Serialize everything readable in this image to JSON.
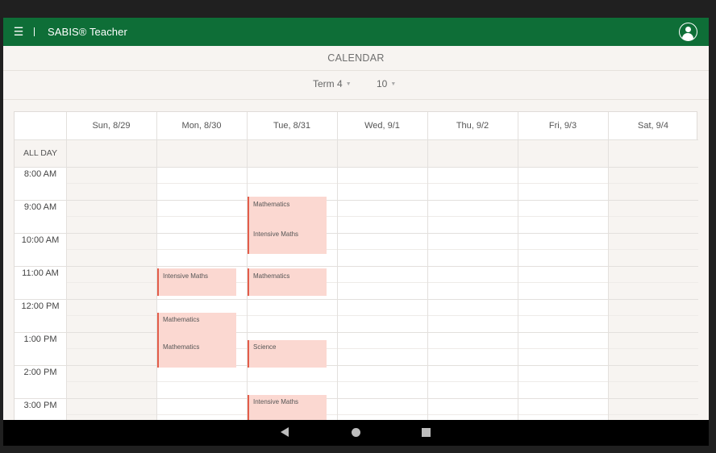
{
  "appbar": {
    "title": "SABIS® Teacher",
    "menu_icon": "hamburger-menu-icon",
    "separator": "|",
    "account_icon": "account-circle-icon",
    "color": "#0e6e37"
  },
  "calendar": {
    "title": "CALENDAR",
    "term_select": {
      "value": "Term 4"
    },
    "week_select": {
      "value": "10"
    },
    "all_day_label": "ALL DAY",
    "days": [
      "Sun, 8/29",
      "Mon, 8/30",
      "Tue, 8/31",
      "Wed, 9/1",
      "Thu, 9/2",
      "Fri, 9/3",
      "Sat, 9/4"
    ],
    "times": [
      "8:00 AM",
      "9:00 AM",
      "10:00 AM",
      "11:00 AM",
      "12:00 PM",
      "1:00 PM",
      "2:00 PM",
      "3:00 PM"
    ],
    "events": [
      {
        "day": "Tue, 8/31",
        "start": "9:00 AM",
        "end": "10:40 AM",
        "title": "Mathematics",
        "subtitle": "Intensive Maths"
      },
      {
        "day": "Mon, 8/30",
        "start": "11:00 AM",
        "end": "11:50 AM",
        "title": "Intensive Maths",
        "subtitle": ""
      },
      {
        "day": "Tue, 8/31",
        "start": "11:00 AM",
        "end": "11:50 AM",
        "title": "Mathematics",
        "subtitle": ""
      },
      {
        "day": "Mon, 8/30",
        "start": "12:20 PM",
        "end": "2:00 PM",
        "title": "Mathematics",
        "subtitle": "Mathematics"
      },
      {
        "day": "Tue, 8/31",
        "start": "1:15 PM",
        "end": "2:05 PM",
        "title": "Science",
        "subtitle": ""
      },
      {
        "day": "Tue, 8/31",
        "start": "2:55 PM",
        "end": "",
        "title": "Intensive Maths",
        "subtitle": ""
      }
    ],
    "event_color": "#fbd8d1",
    "event_accent": "#e35d4a"
  },
  "navbar": {
    "back_icon": "back-triangle-icon",
    "home_icon": "home-circle-icon",
    "recents_icon": "recents-square-icon"
  }
}
